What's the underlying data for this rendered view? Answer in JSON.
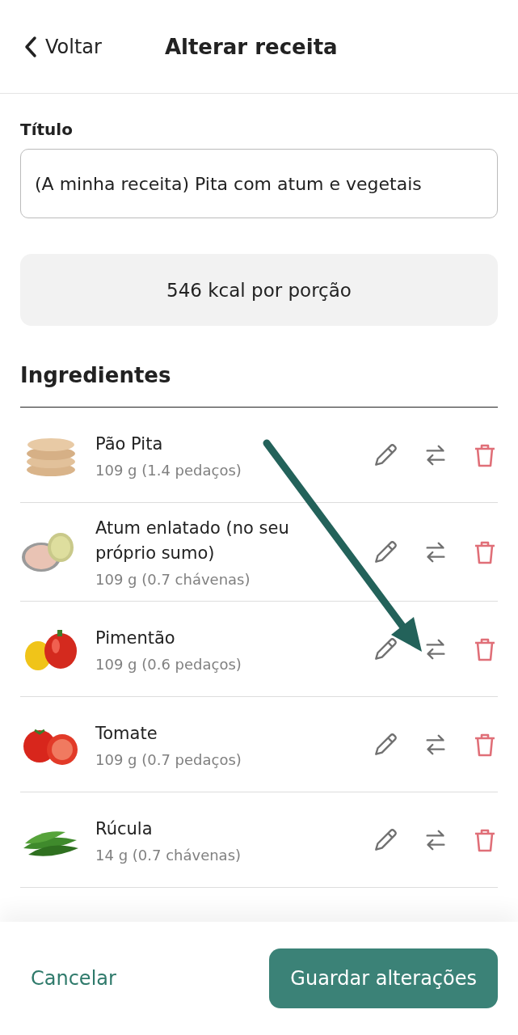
{
  "header": {
    "back": "Voltar",
    "title": "Alterar receita"
  },
  "title_field": {
    "label": "Título",
    "value": "(A minha receita) Pita com atum e vegetais"
  },
  "calories": "546 kcal por porção",
  "ingredients": {
    "heading": "Ingredientes",
    "items": [
      {
        "name": "Pão Pita",
        "amount": "109 g (1.4 pedaços)"
      },
      {
        "name": "Atum enlatado (no seu próprio sumo)",
        "amount": "109 g (0.7 chávenas)"
      },
      {
        "name": "Pimentão",
        "amount": "109 g (0.6 pedaços)"
      },
      {
        "name": "Tomate",
        "amount": "109 g (0.7 pedaços)"
      },
      {
        "name": "Rúcula",
        "amount": "14 g (0.7 chávenas)"
      }
    ]
  },
  "annotation_arrow": true,
  "footer": {
    "cancel": "Cancelar",
    "save": "Guardar alterações"
  }
}
